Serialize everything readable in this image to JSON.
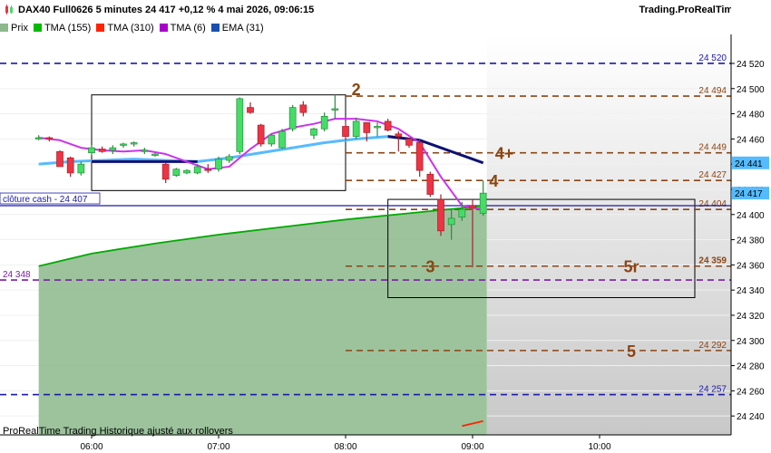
{
  "header": {
    "title": "DAX40 Full0626 5 minutes 24 417 +0,12 % 4 mai 2026, 09:06:15",
    "brand": "Trading.ProRealTime.com"
  },
  "legend": [
    {
      "label": "Prix",
      "color": "#8cb88c"
    },
    {
      "label": "TMA (155)",
      "color": "#00bb00"
    },
    {
      "label": "TMA (310)",
      "color": "#ff2200"
    },
    {
      "label": "TMA (6)",
      "color": "#aa00cc"
    },
    {
      "label": "EMA (31)",
      "color": "#1a4fb0"
    }
  ],
  "footer_note": "ProRealTime Trading  Historique ajusté aux rollovers",
  "colors": {
    "bull": "#44dd66",
    "bear": "#ee3344",
    "tma155": "#00aa00",
    "tma310": "#ff2200",
    "tma6": "#cc33ee",
    "ema31": "#55bbff",
    "ema31_down": "#101070",
    "level_blue": "#1a1aaa",
    "level_brown": "#8b4513",
    "level_purple": "#7a1fa2",
    "close_line": "#1a1aaa",
    "price_tag": "#55bbff",
    "area_fill": "#8cb88c"
  },
  "chart_data": {
    "type": "candlestick",
    "ylim": [
      24225,
      24543
    ],
    "y_ticks": [
      24240,
      24260,
      24280,
      24300,
      24320,
      24340,
      24360,
      24380,
      24400,
      24420,
      24440,
      24460,
      24480,
      24500,
      24520
    ],
    "y_tick_labels": [
      "24 240",
      "24 260",
      "24 280",
      "24 300",
      "24 320",
      "24 340",
      "24 360",
      "24 380",
      "24 400",
      "24 420",
      "24 440",
      "24 460",
      "24 480",
      "24 500",
      "24 520"
    ],
    "x_ticks": [
      "06:00",
      "07:00",
      "08:00",
      "09:00",
      "10:00"
    ],
    "candles": [
      {
        "t": "05:35",
        "o": 24461,
        "h": 24463,
        "l": 24459,
        "c": 24461
      },
      {
        "t": "05:40",
        "o": 24461,
        "h": 24462,
        "l": 24458,
        "c": 24460
      },
      {
        "t": "05:45",
        "o": 24450,
        "h": 24451,
        "l": 24440,
        "c": 24438
      },
      {
        "t": "05:50",
        "o": 24445,
        "h": 24446,
        "l": 24430,
        "c": 24433
      },
      {
        "t": "05:55",
        "o": 24433,
        "h": 24442,
        "l": 24431,
        "c": 24440
      },
      {
        "t": "06:00",
        "o": 24449,
        "h": 24455,
        "l": 24447,
        "c": 24453
      },
      {
        "t": "06:05",
        "o": 24452,
        "h": 24454,
        "l": 24449,
        "c": 24450
      },
      {
        "t": "06:10",
        "o": 24451,
        "h": 24455,
        "l": 24448,
        "c": 24453
      },
      {
        "t": "06:15",
        "o": 24455,
        "h": 24457,
        "l": 24453,
        "c": 24456
      },
      {
        "t": "06:20",
        "o": 24456,
        "h": 24458,
        "l": 24454,
        "c": 24457
      },
      {
        "t": "06:25",
        "o": 24451,
        "h": 24453,
        "l": 24448,
        "c": 24451
      },
      {
        "t": "06:30",
        "o": 24447,
        "h": 24449,
        "l": 24446,
        "c": 24448
      },
      {
        "t": "06:35",
        "o": 24440,
        "h": 24441,
        "l": 24425,
        "c": 24428
      },
      {
        "t": "06:40",
        "o": 24431,
        "h": 24437,
        "l": 24430,
        "c": 24436
      },
      {
        "t": "06:45",
        "o": 24433,
        "h": 24436,
        "l": 24432,
        "c": 24435
      },
      {
        "t": "06:50",
        "o": 24433,
        "h": 24440,
        "l": 24432,
        "c": 24438
      },
      {
        "t": "06:55",
        "o": 24436,
        "h": 24440,
        "l": 24433,
        "c": 24435
      },
      {
        "t": "07:00",
        "o": 24436,
        "h": 24446,
        "l": 24434,
        "c": 24444
      },
      {
        "t": "07:05",
        "o": 24443,
        "h": 24448,
        "l": 24441,
        "c": 24446
      },
      {
        "t": "07:10",
        "o": 24450,
        "h": 24493,
        "l": 24448,
        "c": 24492
      },
      {
        "t": "07:15",
        "o": 24485,
        "h": 24489,
        "l": 24480,
        "c": 24481
      },
      {
        "t": "07:20",
        "o": 24471,
        "h": 24472,
        "l": 24454,
        "c": 24456
      },
      {
        "t": "07:25",
        "o": 24456,
        "h": 24464,
        "l": 24454,
        "c": 24463
      },
      {
        "t": "07:30",
        "o": 24453,
        "h": 24468,
        "l": 24452,
        "c": 24466
      },
      {
        "t": "07:35",
        "o": 24468,
        "h": 24487,
        "l": 24466,
        "c": 24485
      },
      {
        "t": "07:40",
        "o": 24487,
        "h": 24490,
        "l": 24478,
        "c": 24481
      },
      {
        "t": "07:45",
        "o": 24463,
        "h": 24469,
        "l": 24460,
        "c": 24468
      },
      {
        "t": "07:50",
        "o": 24468,
        "h": 24481,
        "l": 24466,
        "c": 24478
      },
      {
        "t": "07:55",
        "o": 24483,
        "h": 24495,
        "l": 24476,
        "c": 24484
      },
      {
        "t": "08:00",
        "o": 24470,
        "h": 24474,
        "l": 24459,
        "c": 24462
      },
      {
        "t": "08:05",
        "o": 24462,
        "h": 24477,
        "l": 24460,
        "c": 24474
      },
      {
        "t": "08:10",
        "o": 24473,
        "h": 24473,
        "l": 24458,
        "c": 24465
      },
      {
        "t": "08:15",
        "o": 24470,
        "h": 24473,
        "l": 24462,
        "c": 24470
      },
      {
        "t": "08:20",
        "o": 24474,
        "h": 24476,
        "l": 24466,
        "c": 24467
      },
      {
        "t": "08:25",
        "o": 24464,
        "h": 24466,
        "l": 24450,
        "c": 24462
      },
      {
        "t": "08:30",
        "o": 24460,
        "h": 24461,
        "l": 24453,
        "c": 24455
      },
      {
        "t": "08:35",
        "o": 24457,
        "h": 24460,
        "l": 24430,
        "c": 24435
      },
      {
        "t": "08:40",
        "o": 24432,
        "h": 24434,
        "l": 24414,
        "c": 24416
      },
      {
        "t": "08:45",
        "o": 24412,
        "h": 24416,
        "l": 24383,
        "c": 24387
      },
      {
        "t": "08:50",
        "o": 24392,
        "h": 24404,
        "l": 24380,
        "c": 24397
      },
      {
        "t": "08:55",
        "o": 24398,
        "h": 24410,
        "l": 24395,
        "c": 24404
      },
      {
        "t": "09:00",
        "o": 24407,
        "h": 24412,
        "l": 24358,
        "c": 24405
      },
      {
        "t": "09:05",
        "o": 24401,
        "h": 24427,
        "l": 24399,
        "c": 24417
      }
    ],
    "series": [
      {
        "name": "TMA (155)",
        "x": [
          "05:35",
          "06:00",
          "06:30",
          "07:00",
          "07:30",
          "08:00",
          "08:30",
          "09:00",
          "09:05"
        ],
        "y": [
          24359,
          24369,
          24377,
          24384,
          24390,
          24396,
          24401,
          24406,
          24407
        ]
      },
      {
        "name": "TMA (310)",
        "x": [
          "08:55",
          "09:05"
        ],
        "y": [
          24232,
          24236
        ]
      },
      {
        "name": "TMA (6)",
        "x": [
          "05:35",
          "05:45",
          "05:55",
          "06:05",
          "06:15",
          "06:25",
          "06:35",
          "06:45",
          "06:55",
          "07:05",
          "07:15",
          "07:25",
          "07:35",
          "07:45",
          "07:55",
          "08:05",
          "08:15",
          "08:25",
          "08:35",
          "08:45",
          "08:55",
          "09:05"
        ],
        "y": [
          24461,
          24459,
          24453,
          24451,
          24450,
          24451,
          24448,
          24442,
          24436,
          24438,
          24452,
          24464,
          24469,
          24472,
          24476,
          24476,
          24474,
          24468,
          24457,
          24430,
          24407,
          24404
        ]
      },
      {
        "name": "EMA (31)",
        "x": [
          "05:35",
          "05:50",
          "06:05",
          "06:20",
          "06:35",
          "06:50",
          "07:05",
          "07:20",
          "07:35",
          "07:50",
          "08:05",
          "08:20",
          "08:35",
          "08:50",
          "09:05"
        ],
        "y": [
          24440,
          24442,
          24443,
          24444,
          24443,
          24442,
          24445,
          24449,
          24453,
          24457,
          24460,
          24462,
          24459,
          24450,
          24441
        ]
      }
    ],
    "ema_segment_x": [
      "06:00",
      "06:50"
    ],
    "ema_segment_y": [
      24442,
      24442
    ],
    "levels": [
      {
        "y": 24520,
        "label": "24 520",
        "color": "level_blue",
        "style": "dash"
      },
      {
        "y": 24494,
        "label": "24 494",
        "color": "level_brown",
        "style": "dash"
      },
      {
        "y": 24449,
        "label": "24 449",
        "color": "level_brown",
        "style": "dash"
      },
      {
        "y": 24427,
        "label": "24 427",
        "color": "level_brown",
        "style": "dash"
      },
      {
        "y": 24404,
        "label": "24 404",
        "color": "level_brown",
        "style": "dash"
      },
      {
        "y": 24359,
        "label": "24 359",
        "color": "level_brown",
        "style": "dash"
      },
      {
        "y": 24348,
        "label": "24 348",
        "color": "level_purple",
        "style": "dash",
        "label_side": "left"
      },
      {
        "y": 24292,
        "label": "24 292",
        "color": "level_brown",
        "style": "dash"
      },
      {
        "y": 24257,
        "label": "24 257",
        "color": "level_blue",
        "style": "dash"
      }
    ],
    "close_cash": {
      "y": 24407,
      "label": "clôture cash -  24 407"
    },
    "wave_labels": [
      {
        "t": "08:05",
        "y": 24500,
        "text": "2"
      },
      {
        "t": "09:15",
        "y": 24449,
        "text": "4+"
      },
      {
        "t": "09:10",
        "y": 24427,
        "text": "4"
      },
      {
        "t": "08:40",
        "y": 24359,
        "text": "3"
      },
      {
        "t": "10:15",
        "y": 24359,
        "text": "5r"
      },
      {
        "t": "10:15",
        "y": 24292,
        "text": "5"
      }
    ],
    "boxes": [
      {
        "t1": "06:00",
        "t2": "08:00",
        "y1": 24419,
        "y2": 24495
      },
      {
        "t1": "08:20",
        "t2": "10:45",
        "y1": 24334,
        "y2": 24412
      }
    ],
    "price_tags": [
      {
        "y": 24441,
        "label": "24 441",
        "color": "price_tag"
      },
      {
        "y": 24417,
        "label": "24 417",
        "color": "price_tag"
      }
    ]
  }
}
